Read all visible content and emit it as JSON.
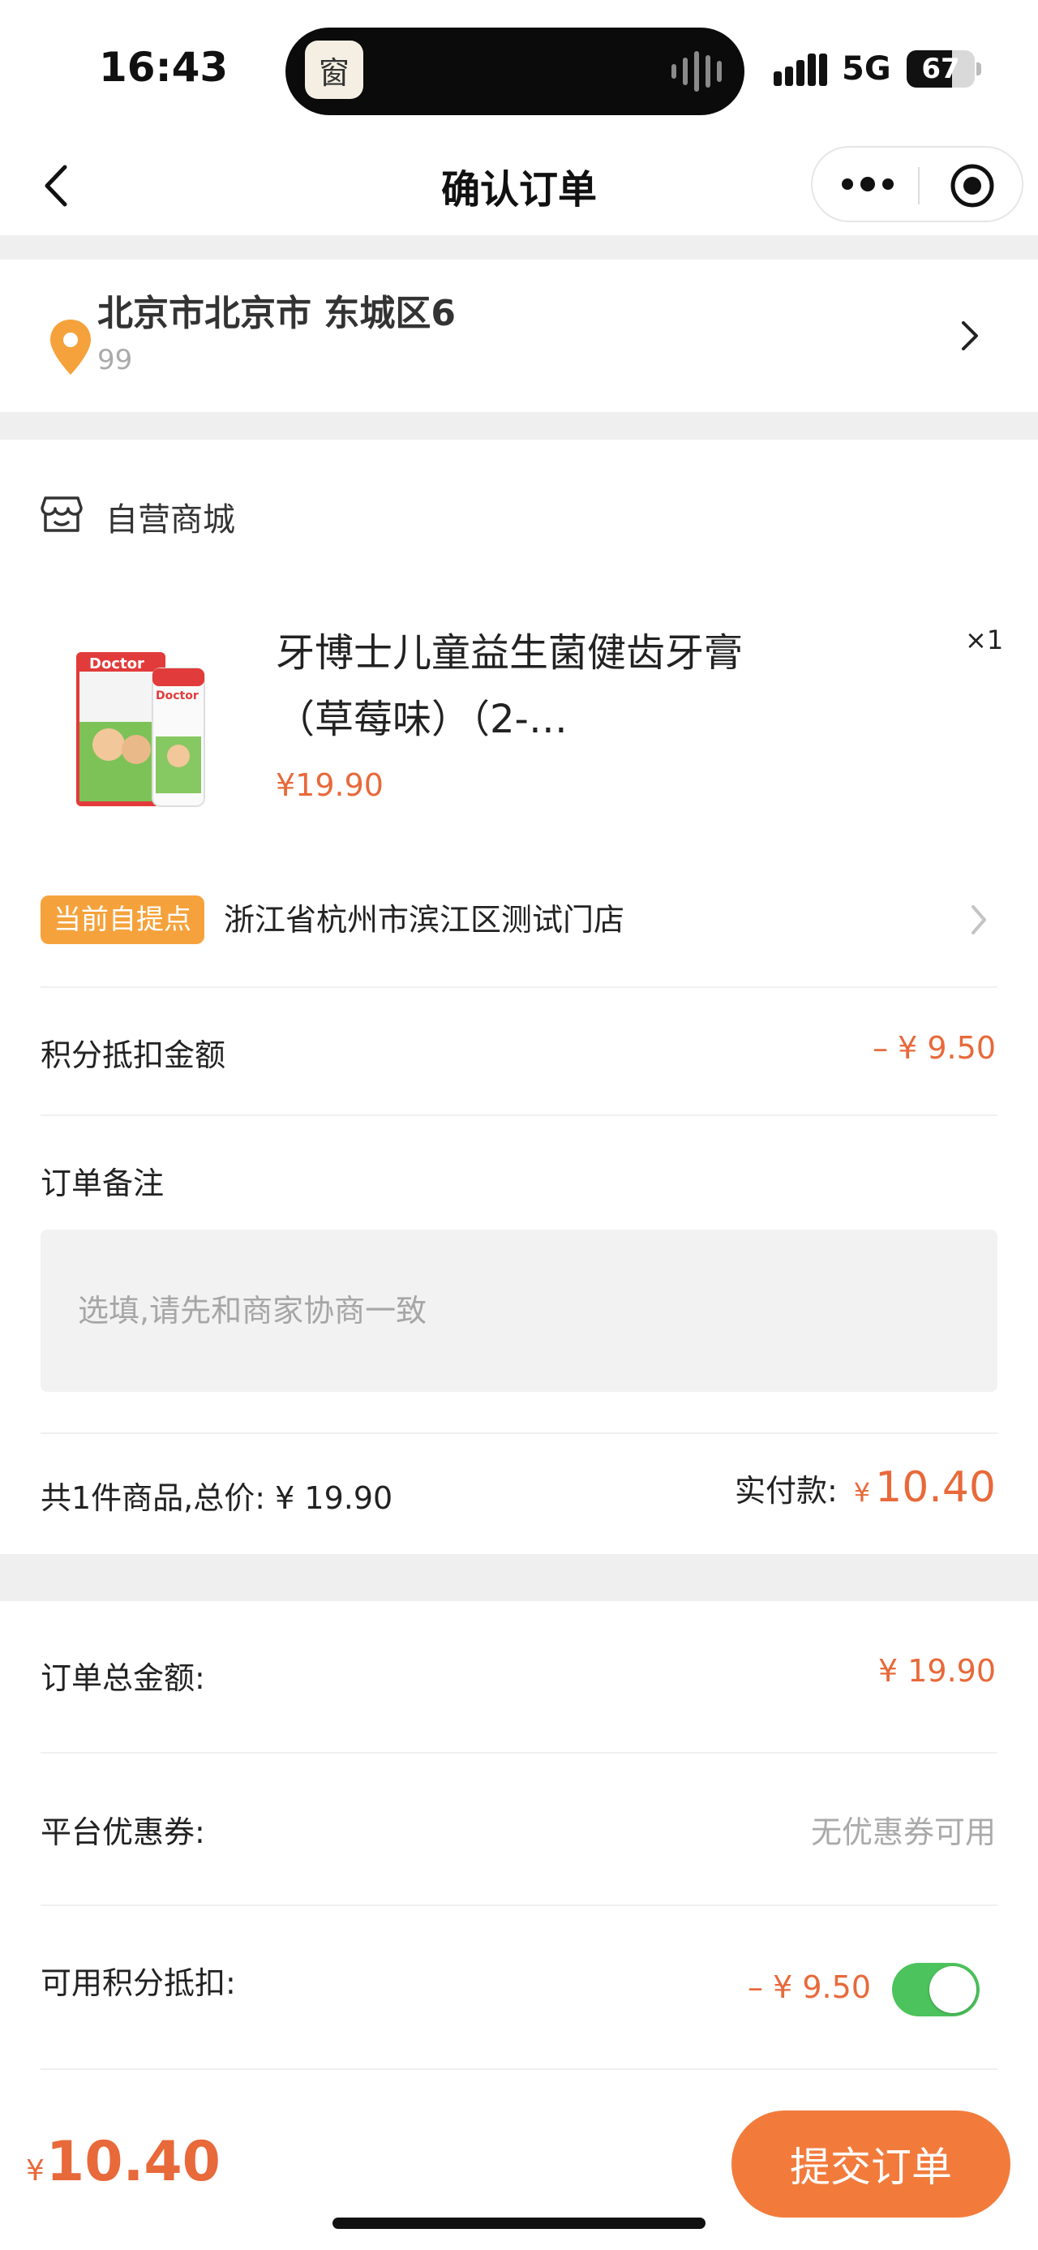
{
  "status_bar": {
    "time": "16:43",
    "network": "5G",
    "battery": "67",
    "battery_level": 0.67,
    "app_icon_glyph": "窗"
  },
  "nav": {
    "title": "确认订单",
    "back_icon": "chevron-left-icon",
    "more_icon": "more-dots-icon",
    "close_icon": "target-circle-icon"
  },
  "address": {
    "line1": "北京市北京市 东城区6",
    "line2": "99",
    "icon": "location-pin-icon"
  },
  "store": {
    "name": "自营商城",
    "icon": "store-icon"
  },
  "product": {
    "name": "牙博士儿童益生菌健齿牙膏（草莓味）（2-…",
    "price": "¥19.90",
    "quantity": "×1",
    "image_brand": "Doctor"
  },
  "pickup": {
    "tag": "当前自提点",
    "address": "浙江省杭州市滨江区测试门店"
  },
  "points_deduction": {
    "label": "积分抵扣金额",
    "value": "– ¥ 9.50"
  },
  "remark": {
    "label": "订单备注",
    "placeholder": "选填,请先和商家协商一致"
  },
  "summary": {
    "left": "共1件商品,总价: ¥ 19.90",
    "pay_label": "实付款:",
    "currency": "¥",
    "pay_amount": "10.40"
  },
  "totals": {
    "order_total_label": "订单总金额:",
    "order_total_value": "¥ 19.90",
    "coupon_label": "平台优惠券:",
    "coupon_value": "无优惠券可用",
    "points_label": "可用积分抵扣:",
    "points_value": "– ¥ 9.50",
    "points_enabled": true
  },
  "bottom_bar": {
    "currency": "¥",
    "amount": "10.40",
    "submit_label": "提交订单"
  },
  "colors": {
    "accent": "#e8693a",
    "tag": "#f5a23c",
    "button": "#f27b3c",
    "toggle_on": "#4cc35c",
    "background": "#efefef"
  }
}
